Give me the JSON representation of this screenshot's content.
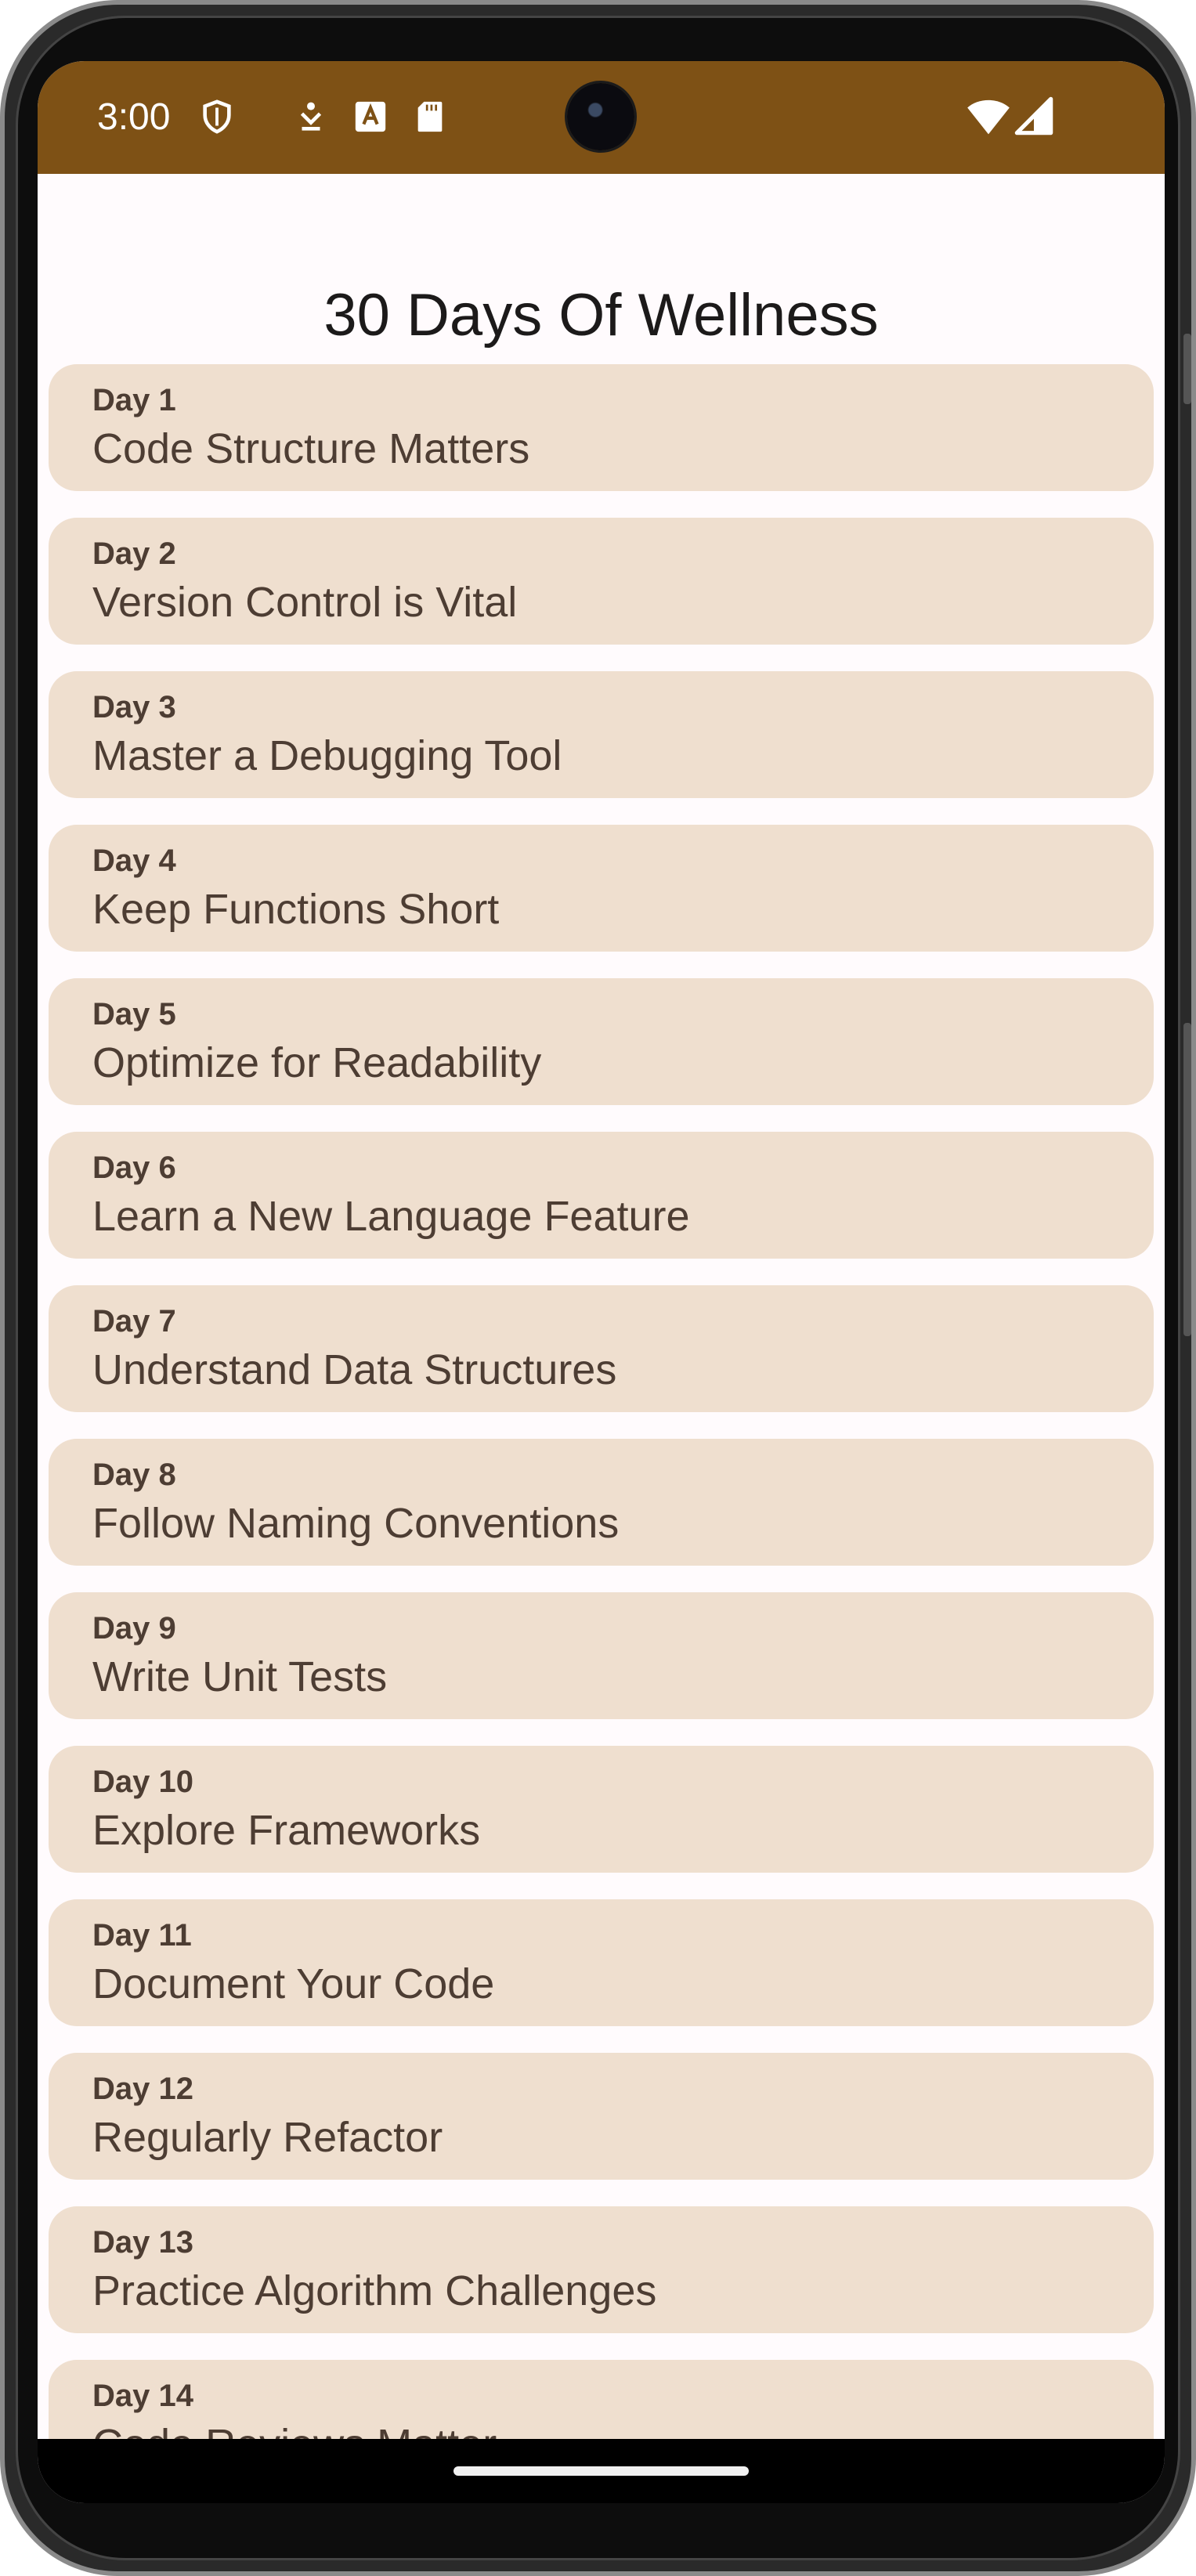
{
  "status_bar": {
    "time": "3:00",
    "background_color": "#7e5115",
    "icons": [
      "shield-icon",
      "download-icon",
      "font-a-icon",
      "sd-card-icon",
      "wifi-icon",
      "cell-signal-icon"
    ]
  },
  "app": {
    "title": "30 Days Of Wellness",
    "card_color": "#efdfcf",
    "text_color": "#4d3d33"
  },
  "days": [
    {
      "day": "Day 1",
      "title": "Code Structure Matters"
    },
    {
      "day": "Day 2",
      "title": "Version Control is Vital"
    },
    {
      "day": "Day 3",
      "title": "Master a Debugging Tool"
    },
    {
      "day": "Day 4",
      "title": "Keep Functions Short"
    },
    {
      "day": "Day 5",
      "title": "Optimize for Readability"
    },
    {
      "day": "Day 6",
      "title": "Learn a New Language Feature"
    },
    {
      "day": "Day 7",
      "title": "Understand Data Structures"
    },
    {
      "day": "Day 8",
      "title": "Follow Naming Conventions"
    },
    {
      "day": "Day 9",
      "title": "Write Unit Tests"
    },
    {
      "day": "Day 10",
      "title": "Explore Frameworks"
    },
    {
      "day": "Day 11",
      "title": "Document Your Code"
    },
    {
      "day": "Day 12",
      "title": "Regularly Refactor"
    },
    {
      "day": "Day 13",
      "title": "Practice Algorithm Challenges"
    },
    {
      "day": "Day 14",
      "title": "Code Reviews Matter"
    }
  ]
}
